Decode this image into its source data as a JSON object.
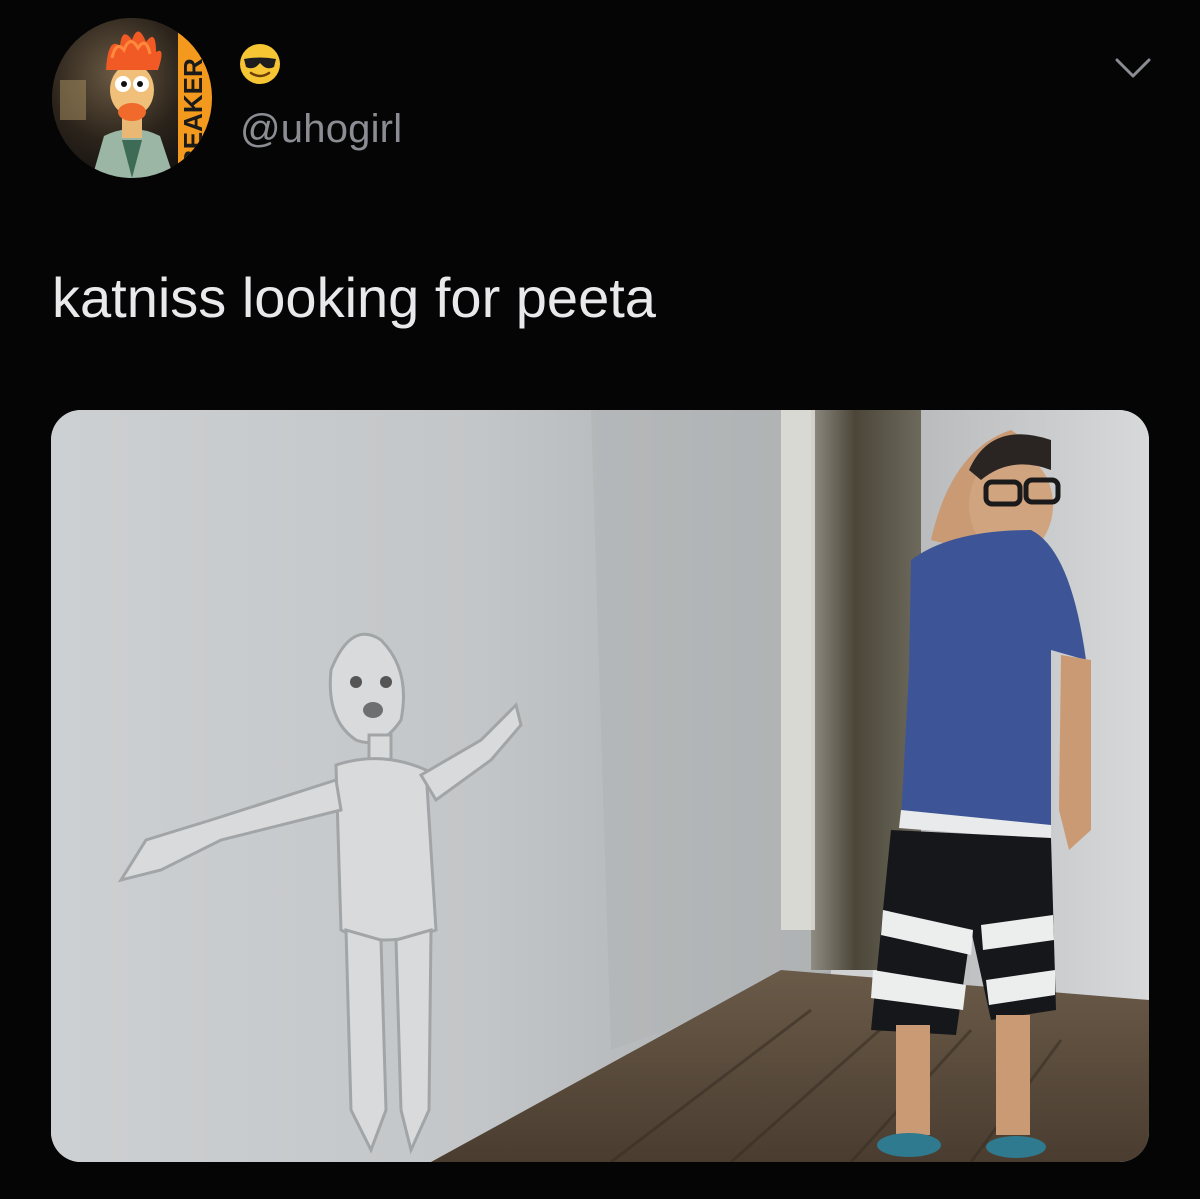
{
  "author": {
    "handle": "@uhogirl",
    "avatar_icon": "beaker-muppet-avatar",
    "avatar_badge_text": "BEAKER",
    "badge_icon": "sunglasses-emoji-icon"
  },
  "tweet": {
    "text": "katniss looking for peeta"
  },
  "menu": {
    "icon": "chevron-down-icon"
  },
  "media": {
    "kind": "photo"
  },
  "colors": {
    "background": "#050506",
    "handle_text": "#8b8d93",
    "body_text": "#e9e9eb"
  }
}
